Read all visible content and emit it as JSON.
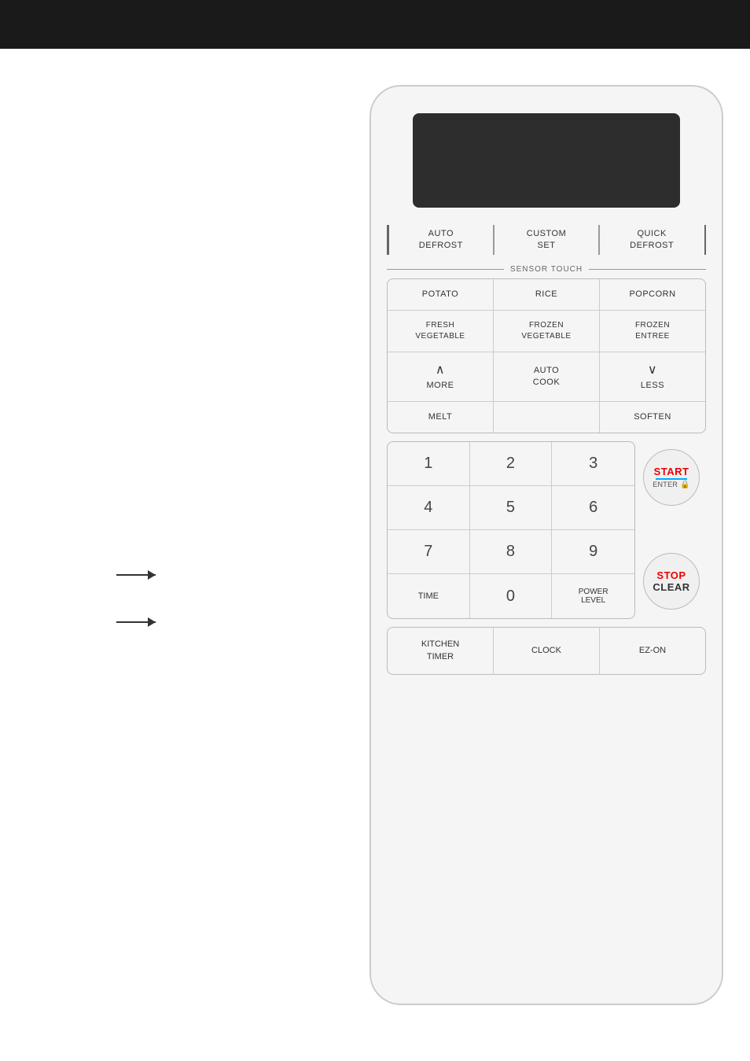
{
  "header": {
    "background": "#1a1a1a"
  },
  "microwave": {
    "display": "",
    "topRow": {
      "autoDefrost": "AUTO\nDEFROST",
      "customSet": "CUSTOM\nSET",
      "quickDefrost": "QUICK\nDEFROST"
    },
    "sensorTouch": {
      "label": "SENSOR TOUCH"
    },
    "sensorRow1": {
      "potato": "POTATO",
      "rice": "RICE",
      "popcorn": "POPCORN"
    },
    "sensorRow2": {
      "freshVeg": "FRESH\nVEGETABLE",
      "frozenVeg": "FROZEN\nVEGETABLE",
      "frozenEntree": "FROZEN\nENTREE"
    },
    "sensorRow3": {
      "more": "MORE",
      "autoCook": "AUTO\nCOOK",
      "less": "LESS"
    },
    "sensorRow4": {
      "melt": "MELT",
      "empty": "",
      "soften": "SOFTEN"
    },
    "numpad": {
      "1": "1",
      "2": "2",
      "3": "3",
      "4": "4",
      "5": "5",
      "6": "6",
      "7": "7",
      "8": "8",
      "9": "9",
      "time": "TIME",
      "0": "0",
      "powerLevel": "POWER\nLEVEL"
    },
    "startBtn": {
      "start": "START",
      "enter": "ENTER"
    },
    "stopBtn": {
      "stop": "STOP",
      "clear": "CLEAR"
    },
    "bottomRow": {
      "kitchenTimer": "KITCHEN\nTIMER",
      "clock": "CLOCK",
      "ezOn": "EZ-ON"
    }
  }
}
